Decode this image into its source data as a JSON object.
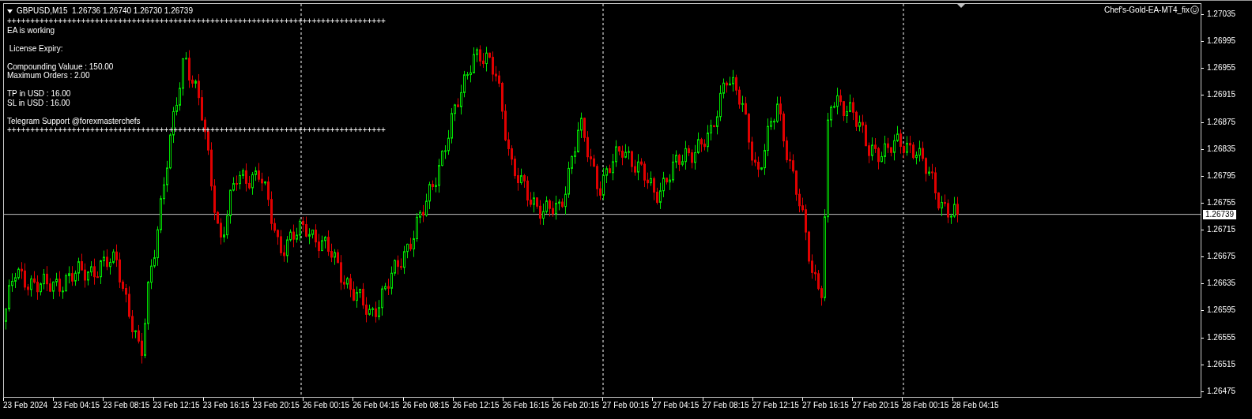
{
  "chart": {
    "symbol_info": "GBPUSD,M15  1.26736 1.26740 1.26730 1.26739",
    "ea_name": "Chef's-Gold-EA-MT4_fix",
    "separator_top": "++++++++++++++++++++++++++++++++++++++++++++++++++++++++++++++++++++++++++++++++++",
    "info_blocks": [
      [
        "EA is working"
      ],
      [
        " License Expiry:"
      ],
      [
        "Compounding Valuue : 150.00",
        "Maximum Orders : 2.00"
      ],
      [
        "TP in USD : 16.00",
        "SL in USD : 16.00"
      ],
      [
        "Telegram Support @forexmasterchefs"
      ]
    ],
    "separator_bottom": "++++++++++++++++++++++++++++++++++++++++++++++++++++++++++++++++++++++++++++++++++",
    "price_axis": {
      "ticks": [
        "1.27035",
        "1.26995",
        "1.26955",
        "1.26915",
        "1.26875",
        "1.26835",
        "1.26795",
        "1.26755",
        "1.26715",
        "1.26675",
        "1.26635",
        "1.26595",
        "1.26555",
        "1.26515",
        "1.26475"
      ],
      "current_price": "1.26739"
    },
    "time_axis": {
      "labels": [
        "23 Feb 2024",
        "23 Feb 04:15",
        "23 Feb 08:15",
        "23 Feb 12:15",
        "23 Feb 16:15",
        "23 Feb 20:15",
        "26 Feb 00:15",
        "26 Feb 04:15",
        "26 Feb 08:15",
        "26 Feb 12:15",
        "26 Feb 16:15",
        "26 Feb 20:15",
        "27 Feb 00:15",
        "27 Feb 04:15",
        "27 Feb 08:15",
        "27 Feb 12:15",
        "27 Feb 16:15",
        "27 Feb 20:15",
        "28 Feb 00:15",
        "28 Feb 04:15"
      ]
    }
  }
}
